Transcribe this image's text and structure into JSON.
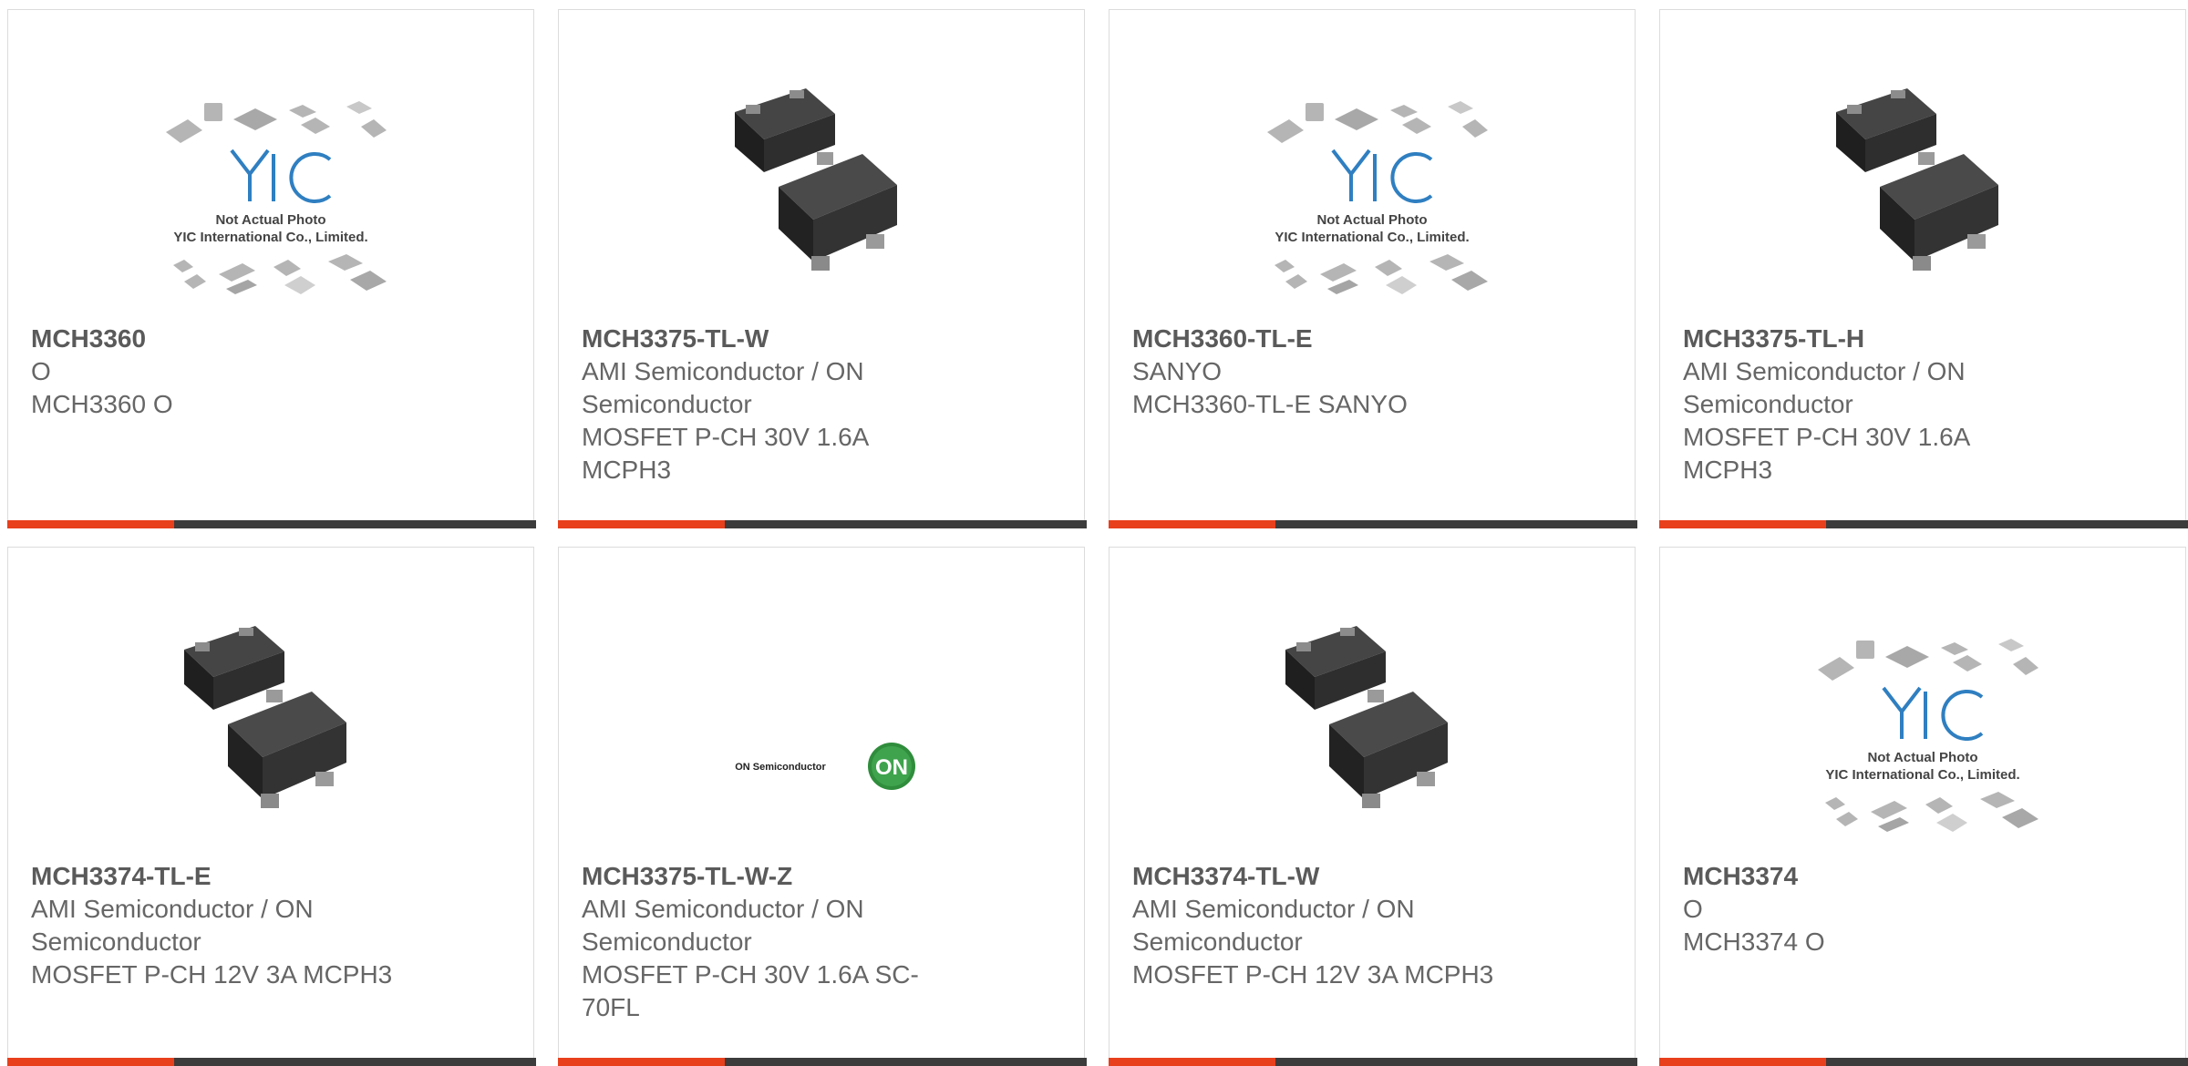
{
  "colors": {
    "accent": "#e8401c",
    "bar": "#3c3c3c",
    "text": "#666666",
    "title": "#5a5a5a",
    "border": "#dcdcdc"
  },
  "products": [
    {
      "part": "MCH3360",
      "image": "placeholder-logo",
      "placeholder_text_1": "Not Actual Photo",
      "placeholder_text_2": "YIC International Co., Limited.",
      "line1": "O",
      "line2": "MCH3360 O",
      "line3": "",
      "line4": ""
    },
    {
      "part": "MCH3375-TL-W",
      "image": "chip-photo",
      "line1": "AMI Semiconductor / ON",
      "line2": "Semiconductor",
      "line3": "MOSFET P-CH 30V 1.6A",
      "line4": "MCPH3"
    },
    {
      "part": "MCH3360-TL-E",
      "image": "placeholder-logo",
      "placeholder_text_1": "Not Actual Photo",
      "placeholder_text_2": "YIC International Co., Limited.",
      "line1": "SANYO",
      "line2": "MCH3360-TL-E SANYO",
      "line3": "",
      "line4": ""
    },
    {
      "part": "MCH3375-TL-H",
      "image": "chip-photo",
      "line1": "AMI Semiconductor / ON",
      "line2": "Semiconductor",
      "line3": "MOSFET P-CH 30V 1.6A",
      "line4": "MCPH3"
    },
    {
      "part": "MCH3374-TL-E",
      "image": "chip-photo",
      "line1": "AMI Semiconductor / ON",
      "line2": "Semiconductor",
      "line3": "MOSFET P-CH 12V 3A MCPH3",
      "line4": ""
    },
    {
      "part": "MCH3375-TL-W-Z",
      "image": "on-semi-logo",
      "logo_text": "ON Semiconductor",
      "logo_badge": "ON",
      "line1": "AMI Semiconductor / ON",
      "line2": "Semiconductor",
      "line3": "MOSFET P-CH 30V 1.6A SC-",
      "line4": "70FL"
    },
    {
      "part": "MCH3374-TL-W",
      "image": "chip-photo",
      "line1": "AMI Semiconductor / ON",
      "line2": "Semiconductor",
      "line3": "MOSFET P-CH 12V 3A MCPH3",
      "line4": ""
    },
    {
      "part": "MCH3374",
      "image": "placeholder-logo",
      "placeholder_text_1": "Not Actual Photo",
      "placeholder_text_2": "YIC International Co., Limited.",
      "line1": "O",
      "line2": "MCH3374 O",
      "line3": "",
      "line4": ""
    }
  ]
}
